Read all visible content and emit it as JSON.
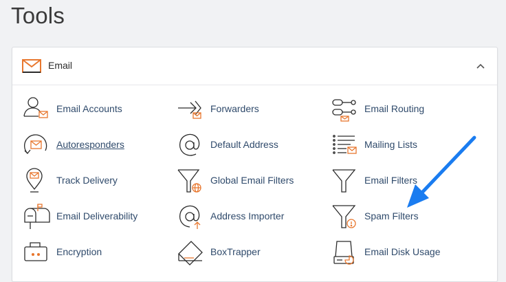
{
  "page": {
    "title": "Tools"
  },
  "panel": {
    "title": "Email",
    "items": [
      {
        "label": "Email Accounts",
        "icon": "email-accounts-icon"
      },
      {
        "label": "Forwarders",
        "icon": "forwarders-icon"
      },
      {
        "label": "Email Routing",
        "icon": "email-routing-icon"
      },
      {
        "label": "Autoresponders",
        "icon": "autoresponders-icon"
      },
      {
        "label": "Default Address",
        "icon": "default-address-icon"
      },
      {
        "label": "Mailing Lists",
        "icon": "mailing-lists-icon"
      },
      {
        "label": "Track Delivery",
        "icon": "track-delivery-icon"
      },
      {
        "label": "Global Email Filters",
        "icon": "global-email-filters-icon"
      },
      {
        "label": "Email Filters",
        "icon": "email-filters-icon"
      },
      {
        "label": "Email Deliverability",
        "icon": "email-deliverability-icon"
      },
      {
        "label": "Address Importer",
        "icon": "address-importer-icon"
      },
      {
        "label": "Spam Filters",
        "icon": "spam-filters-icon"
      },
      {
        "label": "Encryption",
        "icon": "encryption-icon"
      },
      {
        "label": "BoxTrapper",
        "icon": "boxtrapper-icon"
      },
      {
        "label": "Email Disk Usage",
        "icon": "email-disk-usage-icon"
      }
    ]
  },
  "colors": {
    "icon_stroke": "#2b2b2b",
    "icon_accent": "#e8772e",
    "link_text": "#2f4a6b",
    "annotation_arrow": "#1a7cf0"
  }
}
